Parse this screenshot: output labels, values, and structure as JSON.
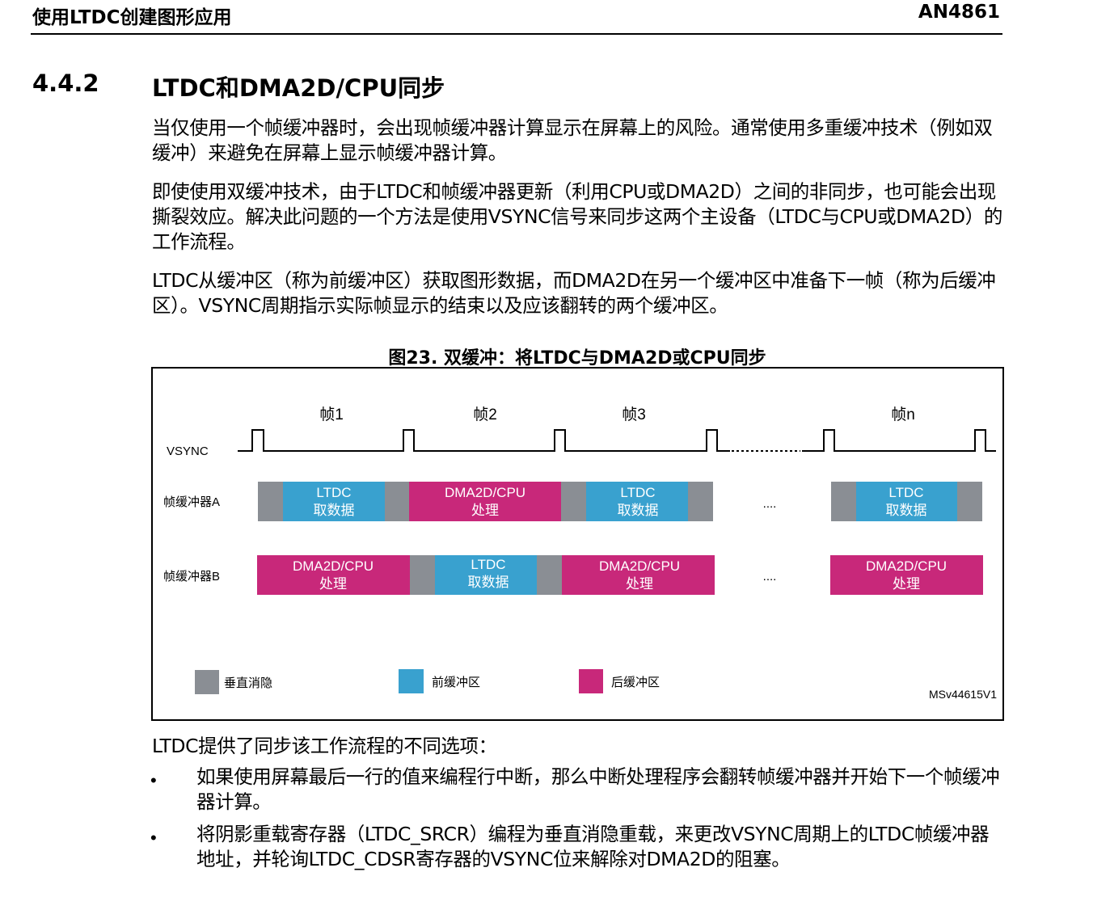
{
  "header": {
    "left_title": "使用LTDC创建图形应用",
    "doc_id": "AN4861"
  },
  "section": {
    "number": "4.4.2",
    "title": "LTDC和DMA2D/CPU同步"
  },
  "paragraphs": [
    "当仅使用一个帧缓冲器时，会出现帧缓冲器计算显示在屏幕上的风险。通常使用多重缓冲技术（例如双缓冲）来避免在屏幕上显示帧缓冲器计算。",
    "即使使用双缓冲技术，由于LTDC和帧缓冲器更新（利用CPU或DMA2D）之间的非同步，也可能会出现撕裂效应。解决此问题的一个方法是使用VSYNC信号来同步这两个主设备（LTDC与CPU或DMA2D）的工作流程。",
    "LTDC从缓冲区（称为前缓冲区）获取图形数据，而DMA2D在另一个缓冲区中准备下一帧（称为后缓冲区）。VSYNC周期指示实际帧显示的结束以及应该翻转的两个缓冲区。"
  ],
  "figure": {
    "caption": "图23. 双缓冲：将LTDC与DMA2D或CPU同步",
    "frames": [
      "帧1",
      "帧2",
      "帧3",
      "帧n"
    ],
    "vsync_label": "VSYNC",
    "row_a_label": "帧缓冲器A",
    "row_b_label": "帧缓冲器B",
    "ltdc_top": "LTDC",
    "ltdc_bottom": "取数据",
    "dma_top": "DMA2D/CPU",
    "dma_bottom": "处理",
    "ellipsis": "....",
    "legend": {
      "vblank": "垂直消隐",
      "front": "前缓冲区",
      "back": "后缓冲区"
    },
    "ref": "MSv44615V1",
    "colors": {
      "vblank": "#8a8e94",
      "front": "#39a1cf",
      "back": "#c8287a"
    }
  },
  "after_text": "LTDC提供了同步该工作流程的不同选项：",
  "bullets": [
    {
      "mark": "•",
      "text": "如果使用屏幕最后一行的值来编程行中断，那么中断处理程序会翻转帧缓冲器并开始下一个帧缓冲器计算。"
    },
    {
      "mark": "•",
      "text": "将阴影重载寄存器（LTDC_SRCR）编程为垂直消隐重载，来更改VSYNC周期上的LTDC帧缓冲器地址，并轮询LTDC_CDSR寄存器的VSYNC位来解除对DMA2D的阻塞。"
    }
  ]
}
